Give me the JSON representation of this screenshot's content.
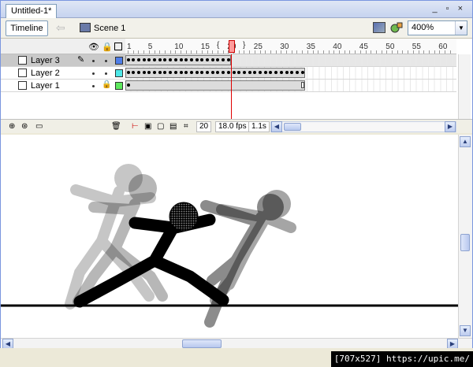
{
  "document": {
    "tab_title": "Untitled-1*",
    "window_buttons": "_ ▫ ×"
  },
  "toolbar": {
    "timeline_label": "Timeline",
    "scene_label": "Scene 1",
    "zoom_value": "400%"
  },
  "timeline": {
    "ruler_numbers": [
      "1",
      "5",
      "10",
      "15",
      "20",
      "25",
      "30",
      "35",
      "40",
      "45",
      "50",
      "55",
      "60"
    ],
    "layers": [
      {
        "name": "Layer 3",
        "selected": true,
        "color": "#4f7ee8"
      },
      {
        "name": "Layer 2",
        "selected": false,
        "color": "#4ee8e8"
      },
      {
        "name": "Layer 1",
        "selected": false,
        "color": "#5ee85e"
      }
    ],
    "current_frame": "20",
    "frame_rate": "18.0 fps",
    "elapsed_time": "1.1s"
  },
  "stage": {
    "zoom": "400%"
  },
  "watermark": "[707x527] https://upic.me/",
  "colors": {
    "playhead": "#e00000",
    "selection": "#c9c9c9",
    "accent": "#7a96df"
  }
}
